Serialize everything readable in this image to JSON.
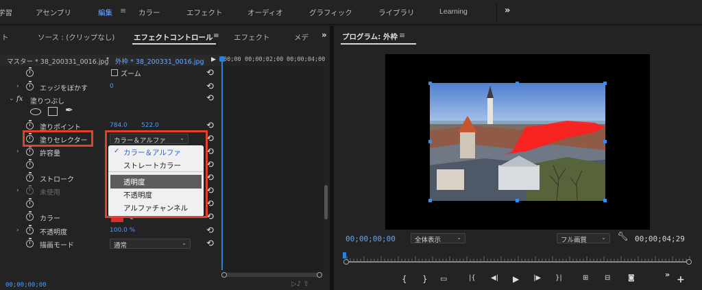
{
  "workspaces": [
    {
      "label": "学習",
      "active": false
    },
    {
      "label": "アセンブリ",
      "active": false
    },
    {
      "label": "編集",
      "active": true
    },
    {
      "label": "カラー",
      "active": false
    },
    {
      "label": "エフェクト",
      "active": false
    },
    {
      "label": "オーディオ",
      "active": false
    },
    {
      "label": "グラフィック",
      "active": false
    },
    {
      "label": "ライブラリ",
      "active": false
    },
    {
      "label": "Learning",
      "active": false
    }
  ],
  "workspace_menu_icon": "hamburger-icon",
  "workspace_more": "»",
  "left_panel": {
    "tabs": {
      "cut": "ト",
      "source": "ソース : (クリップなし)",
      "effect_controls": "エフェクトコントロール",
      "effects": "エフェクト",
      "metadata": "メデ"
    },
    "menu_icon": "≡",
    "more": "»",
    "master_label": "マスター * 38_200331_0016.jpg",
    "clip_label": "外枠 * 38_200331_0016.jpg",
    "ruler": [
      "00;00",
      "00;00;02;00",
      "00;00;04;00"
    ],
    "zoom_label": "ズーム",
    "feather_label": "エッジをぼかす",
    "feather_value": "0",
    "fill_section": "塗りつぶし",
    "fx_glyph": "fx",
    "fill_point_label": "塗りポイント",
    "fill_point_x": "784.0",
    "fill_point_y": "522.0",
    "fill_selector_label": "塗りセレクター",
    "fill_selector_value": "カラー＆アルファ",
    "tolerance_label": "許容量",
    "stroke_label": "ストローク",
    "unused_label": "未使用",
    "color_label": "カラー",
    "color_swatch": "#e02a2a",
    "opacity_label": "不透明度",
    "opacity_value": "100.0 %",
    "blend_label": "描画モード",
    "blend_value": "通常",
    "bottom_timecode": "00;00;00;00"
  },
  "dropdown_menu": {
    "items": [
      {
        "label": "カラー＆アルファ",
        "checked": true
      },
      {
        "label": "ストレートカラー",
        "checked": false
      },
      {
        "label": "透明度",
        "highlighted": true
      },
      {
        "label": "不透明度",
        "highlighted": false
      },
      {
        "label": "アルファチャンネル",
        "highlighted": false
      }
    ],
    "check_glyph": "✓"
  },
  "annotation_color": "#e0432a",
  "program_monitor": {
    "title": "プログラム: 外枠",
    "menu_icon": "≡",
    "current_timecode": "00;00;00;00",
    "fit_value": "全体表示",
    "quality_value": "フル画質",
    "duration_timecode": "00;00;04;29",
    "transport_icons": [
      "mark-in",
      "mark-out",
      "safe-margins",
      "go-to-in",
      "step-back",
      "play",
      "step-forward",
      "go-to-out",
      "lift",
      "extract",
      "export-frame"
    ]
  },
  "accent_blue": "#4e9cff"
}
